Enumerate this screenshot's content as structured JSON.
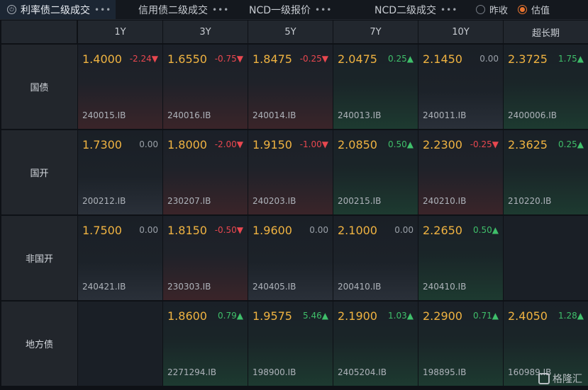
{
  "tabs": [
    {
      "label": "利率债二级成交",
      "active": true
    },
    {
      "label": "信用债二级成交",
      "active": false
    },
    {
      "label": "NCD一级报价",
      "active": false
    },
    {
      "label": "NCD二级成交",
      "active": false
    }
  ],
  "dots": "•••",
  "radios": [
    {
      "label": "昨收",
      "selected": false
    },
    {
      "label": "估值",
      "selected": true
    }
  ],
  "columns": [
    "1Y",
    "3Y",
    "5Y",
    "7Y",
    "10Y",
    "超长期"
  ],
  "rows": [
    {
      "label": "国债",
      "cells": [
        {
          "value": "1.4000",
          "change": "-2.24",
          "dir": "down",
          "code": "240015.IB"
        },
        {
          "value": "1.6550",
          "change": "-0.75",
          "dir": "down",
          "code": "240016.IB"
        },
        {
          "value": "1.8475",
          "change": "-0.25",
          "dir": "down",
          "code": "240014.IB"
        },
        {
          "value": "2.0475",
          "change": "0.25",
          "dir": "up",
          "code": "240013.IB"
        },
        {
          "value": "2.1450",
          "change": "0.00",
          "dir": "flat",
          "code": "240011.IB"
        },
        {
          "value": "2.3725",
          "change": "1.75",
          "dir": "up",
          "code": "2400006.IB"
        }
      ]
    },
    {
      "label": "国开",
      "cells": [
        {
          "value": "1.7300",
          "change": "0.00",
          "dir": "flat",
          "code": "200212.IB"
        },
        {
          "value": "1.8000",
          "change": "-2.00",
          "dir": "down",
          "code": "230207.IB"
        },
        {
          "value": "1.9150",
          "change": "-1.00",
          "dir": "down",
          "code": "240203.IB"
        },
        {
          "value": "2.0850",
          "change": "0.50",
          "dir": "up",
          "code": "200215.IB"
        },
        {
          "value": "2.2300",
          "change": "-0.25",
          "dir": "down",
          "code": "240210.IB"
        },
        {
          "value": "2.3625",
          "change": "0.25",
          "dir": "up",
          "code": "210220.IB"
        }
      ]
    },
    {
      "label": "非国开",
      "cells": [
        {
          "value": "1.7500",
          "change": "0.00",
          "dir": "flat",
          "code": "240421.IB"
        },
        {
          "value": "1.8150",
          "change": "-0.50",
          "dir": "down",
          "code": "230303.IB"
        },
        {
          "value": "1.9600",
          "change": "0.00",
          "dir": "flat",
          "code": "240405.IB"
        },
        {
          "value": "2.1000",
          "change": "0.00",
          "dir": "flat",
          "code": "200410.IB"
        },
        {
          "value": "2.2650",
          "change": "0.50",
          "dir": "up",
          "code": "240410.IB"
        },
        null
      ]
    },
    {
      "label": "地方债",
      "cells": [
        null,
        {
          "value": "1.8600",
          "change": "0.79",
          "dir": "up",
          "code": "2271294.IB"
        },
        {
          "value": "1.9575",
          "change": "5.46",
          "dir": "up",
          "code": "198900.IB"
        },
        {
          "value": "2.1900",
          "change": "1.03",
          "dir": "up",
          "code": "2405204.IB"
        },
        {
          "value": "2.2900",
          "change": "0.71",
          "dir": "up",
          "code": "198895.IB"
        },
        {
          "value": "2.4050",
          "change": "1.28",
          "dir": "up",
          "code": "160989.IB"
        }
      ]
    }
  ],
  "arrows": {
    "up": "▲",
    "down": "▼"
  },
  "watermark": "格隆汇"
}
